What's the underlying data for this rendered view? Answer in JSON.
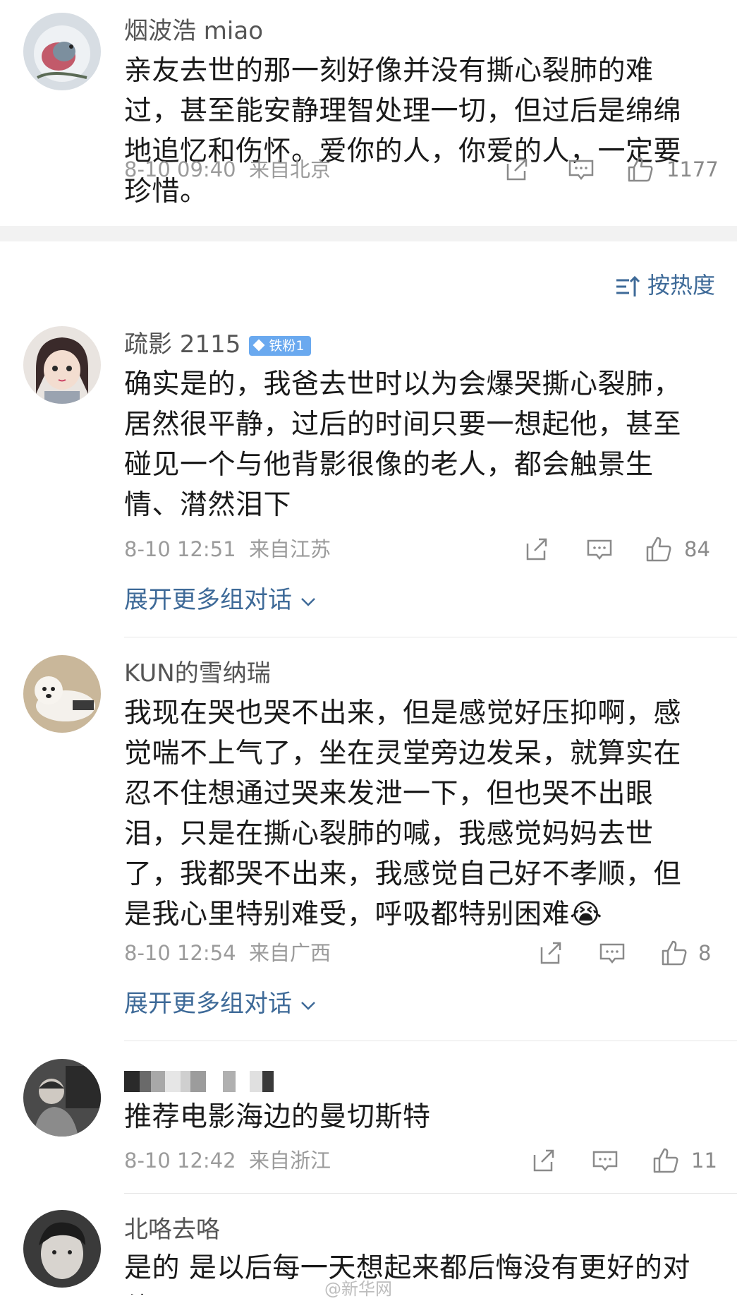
{
  "posts": [
    {
      "name": "烟波浩 miao",
      "text": "亲友去世的那一刻好像并没有撕心裂肺的难过，甚至能安静理智处理一切，但过后是绵绵地追忆和伤怀。爱你的人，你爱的人，一定要珍惜。",
      "time": "8-10 09:40",
      "location": "来自北京",
      "likes": "1177"
    },
    {
      "name": "疏影 2115",
      "badge": "铁粉1",
      "text": "确实是的，我爸去世时以为会爆哭撕心裂肺，居然很平静，过后的时间只要一想起他，甚至碰见一个与他背影很像的老人，都会触景生情、潸然泪下",
      "time": "8-10 12:51",
      "location": "来自江苏",
      "likes": "84",
      "expand": "展开更多组对话"
    },
    {
      "name": "KUN的雪纳瑞",
      "text": "我现在哭也哭不出来，但是感觉好压抑啊，感觉喘不上气了，坐在灵堂旁边发呆，就算实在忍不住想通过哭来发泄一下，但也哭不出眼泪，只是在撕心裂肺的喊，我感觉妈妈去世了，我都哭不出来，我感觉自己好不孝顺，但是我心里特别难受，呼吸都特别困难",
      "emoji": "😭",
      "time": "8-10 12:54",
      "location": "来自广西",
      "likes": "8",
      "expand": "展开更多组对话"
    },
    {
      "name": "",
      "text": "推荐电影海边的曼切斯特",
      "time": "8-10 12:42",
      "location": "来自浙江",
      "likes": "11"
    },
    {
      "name": "北咯去咯",
      "text": "是的 是以后每一天想起来都后悔没有更好的对他"
    }
  ],
  "sort_label": "按热度",
  "watermark": "@新华网",
  "icons": [
    "share-icon",
    "comment-icon",
    "like-icon",
    "sort-icon",
    "chevron-down-icon"
  ]
}
